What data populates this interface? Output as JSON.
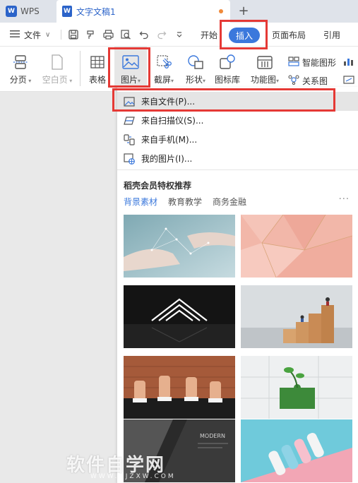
{
  "titlebar": {
    "app_tab": "WPS",
    "doc_tab": "文字文稿1",
    "new_tab_symbol": "+"
  },
  "menubar": {
    "file_menu": "文件",
    "tabs": [
      "开始",
      "插入",
      "页面布局",
      "引用"
    ],
    "active_tab": "插入"
  },
  "ribbon": {
    "page_break": "分页",
    "blank_page": "空白页",
    "table": "表格",
    "picture": "图片",
    "screenshot": "截屏",
    "shapes": "形状",
    "icon_library": "图标库",
    "function_chart": "功能图",
    "smart_art": "智能图形",
    "relation_chart": "关系图"
  },
  "picture_menu": {
    "items": [
      "来自文件(P)...",
      "来自扫描仪(S)...",
      "来自手机(M)...",
      "我的图片(I)..."
    ],
    "section_title": "稻壳会员特权推荐",
    "categories": [
      "背景素材",
      "教育教学",
      "商务金融"
    ],
    "active_category": "背景素材",
    "more_symbol": "···"
  },
  "watermark": {
    "text": "软件自学网",
    "url": "WWW.RJZXW.COM"
  },
  "colors": {
    "accent": "#3b78dc",
    "highlight": "#e53935"
  }
}
